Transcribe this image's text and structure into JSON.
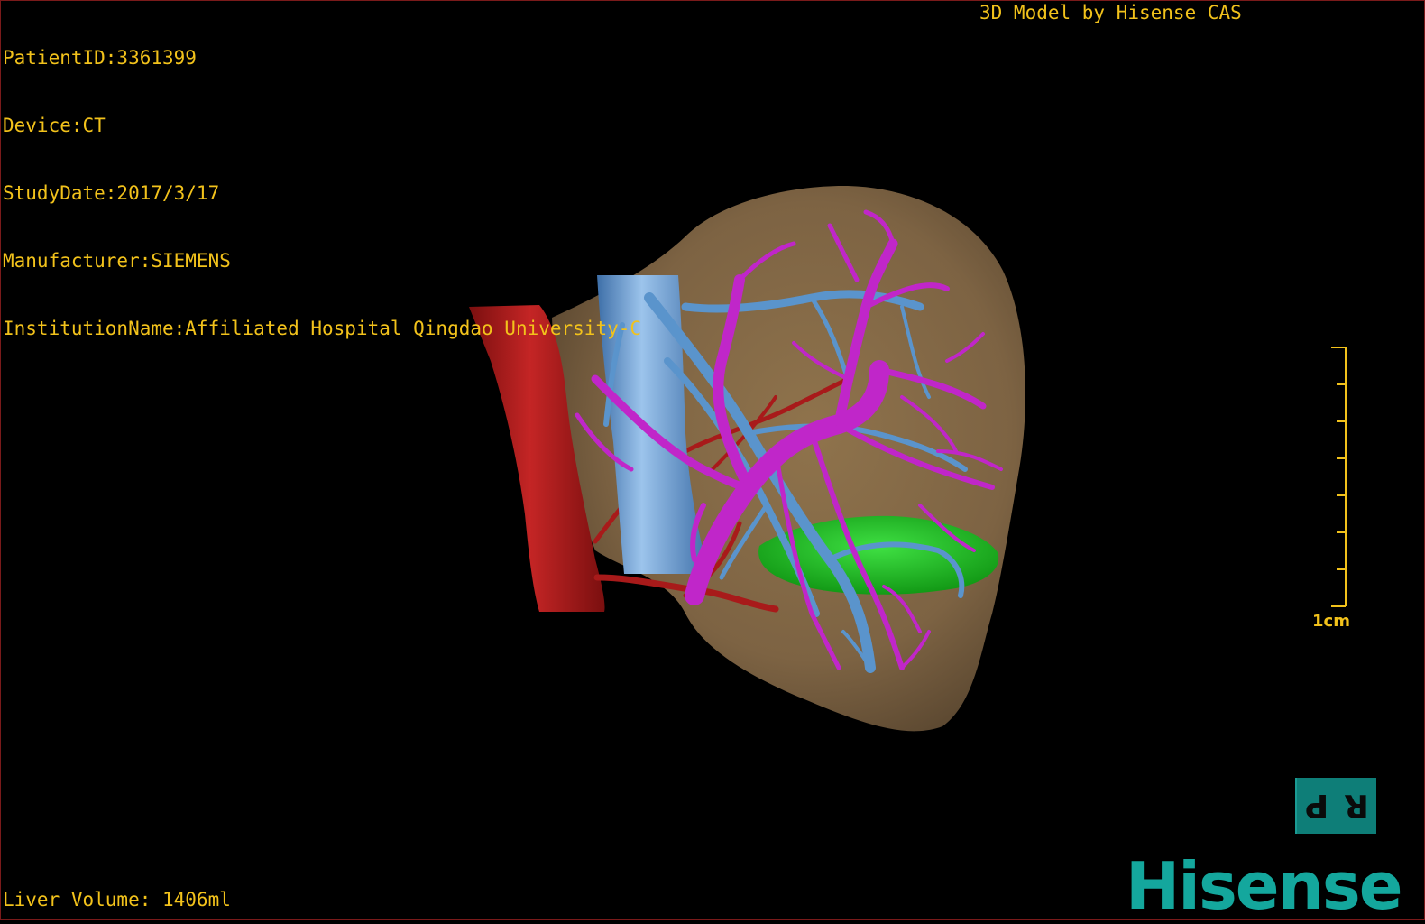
{
  "study_info": {
    "patient_id": "PatientID:3361399",
    "device": "Device:CT",
    "study_date": "StudyDate:2017/3/17",
    "manufacturer": "Manufacturer:SIEMENS",
    "institution": "InstitutionName:Affiliated Hospital Qingdao University-C"
  },
  "credit": "3D Model by Hisense CAS",
  "liver_volume": "Liver Volume: 1406ml",
  "scale_bar": {
    "label": "1cm"
  },
  "orientation_cube": {
    "left": "P",
    "right": "R"
  },
  "brand": "Hisense",
  "colors": {
    "text": "#f2c21b",
    "liver": "#8a6d48",
    "aorta": "#b51d1d",
    "vena_cava": "#6aa2d8",
    "portal_vein": "#c026c9",
    "hepatic_vein": "#5a94cc",
    "gallbladder": "#22b827",
    "brand": "#14a79d"
  }
}
